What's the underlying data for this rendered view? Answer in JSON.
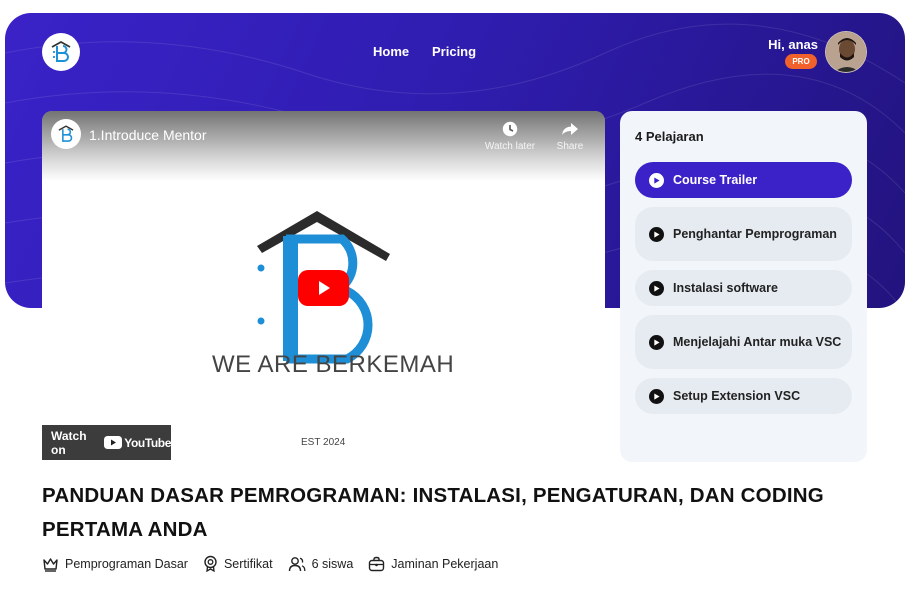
{
  "header": {
    "nav": [
      {
        "label": "Home"
      },
      {
        "label": "Pricing"
      }
    ],
    "greeting": "Hi, anas",
    "badge": "PRO"
  },
  "video": {
    "title": "1.Introduce Mentor",
    "watch_later": "Watch later",
    "share": "Share",
    "brand_text": "WE ARE BERKEMAH",
    "est_text": "EST 2024",
    "watch_on": "Watch on",
    "youtube": "YouTube",
    "play_color": "#ff0000"
  },
  "lessons": {
    "title": "4 Pelajaran",
    "items": [
      {
        "label": "Course Trailer",
        "active": true
      },
      {
        "label": "Penghantar Pemprograman",
        "active": false
      },
      {
        "label": "Instalasi software",
        "active": false
      },
      {
        "label": "Menjelajahi Antar muka VSC",
        "active": false
      },
      {
        "label": "Setup Extension VSC",
        "active": false
      }
    ]
  },
  "course": {
    "title": "PANDUAN DASAR PEMROGRAMAN: INSTALASI, PENGATURAN, DAN CODING PERTAMA ANDA",
    "meta": [
      {
        "icon": "crown-icon",
        "label": "Pemprograman Dasar"
      },
      {
        "icon": "certificate-icon",
        "label": "Sertifikat"
      },
      {
        "icon": "users-icon",
        "label": "6 siswa"
      },
      {
        "icon": "briefcase-icon",
        "label": "Jaminan Pekerjaan"
      }
    ]
  },
  "colors": {
    "hero_start": "#3a22c8",
    "hero_end": "#22137e",
    "accent": "#3a22c8",
    "pro_badge": "#f0612b"
  }
}
